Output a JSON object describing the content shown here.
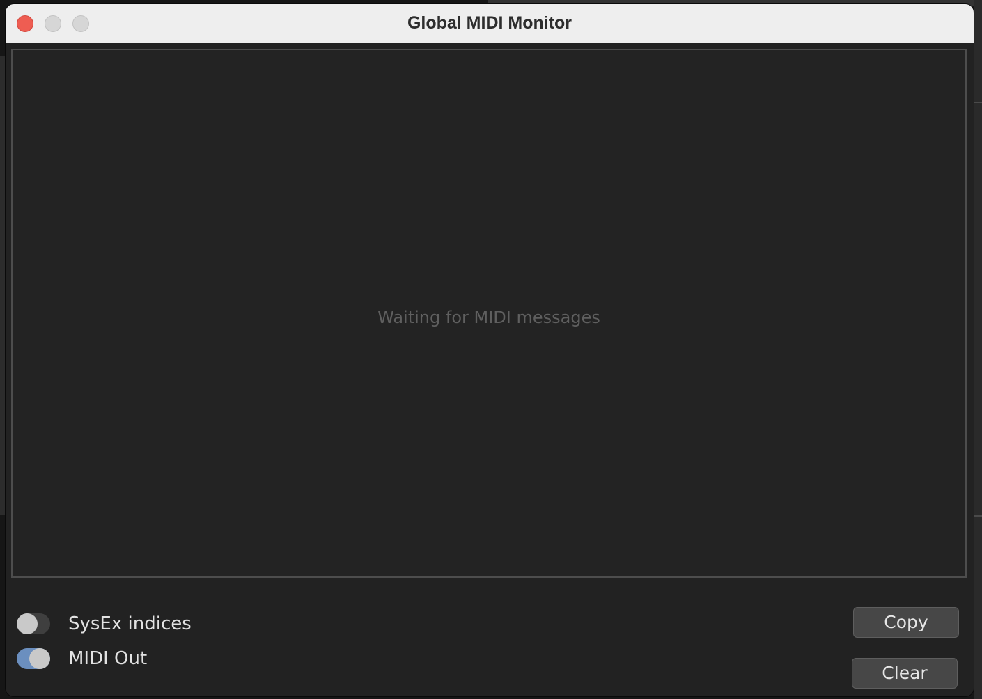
{
  "window": {
    "title": "Global MIDI Monitor"
  },
  "monitor": {
    "placeholder": "Waiting for MIDI messages"
  },
  "options": [
    {
      "label": "SysEx indices",
      "enabled": false
    },
    {
      "label": "MIDI Out",
      "enabled": true
    }
  ],
  "buttons": {
    "copy_label": "Copy",
    "clear_label": "Clear"
  },
  "colors": {
    "close_button": "#ee5d52",
    "toggle_on": "#6b8fbf",
    "toggle_off": "#3f3f3f",
    "panel_background": "#232323"
  }
}
